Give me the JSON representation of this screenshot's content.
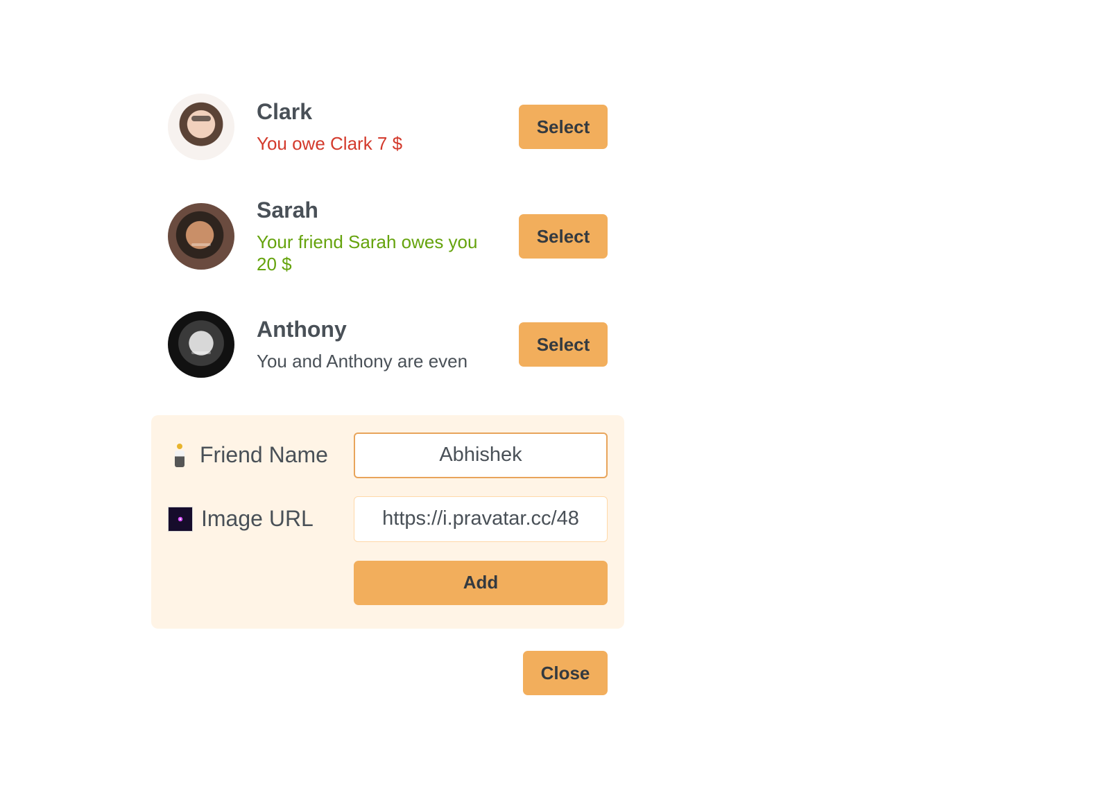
{
  "friends": [
    {
      "name": "Clark",
      "status": "You owe Clark 7 $",
      "status_type": "owe",
      "status_color": "#d33a2c",
      "avatar_icon": "avatar",
      "select_label": "Select"
    },
    {
      "name": "Sarah",
      "status": "Your friend Sarah owes you 20 $",
      "status_type": "owed",
      "status_color": "#65a30d",
      "avatar_icon": "avatar",
      "select_label": "Select"
    },
    {
      "name": "Anthony",
      "status": "You and Anthony are even",
      "status_type": "even",
      "status_color": "#495057",
      "avatar_icon": "avatar",
      "select_label": "Select"
    }
  ],
  "form": {
    "friend_name_label": "Friend Name",
    "friend_name_icon": "person-icon",
    "friend_name_value": "Abhishek",
    "image_url_label": "Image URL",
    "image_url_icon": "firework-icon",
    "image_url_value": "https://i.pravatar.cc/48",
    "add_label": "Add"
  },
  "actions": {
    "close_label": "Close"
  },
  "colors": {
    "accent": "#f2ae5c",
    "form_background": "#fff4e6",
    "input_focus_border": "#e8a45a",
    "text": "#495057"
  }
}
